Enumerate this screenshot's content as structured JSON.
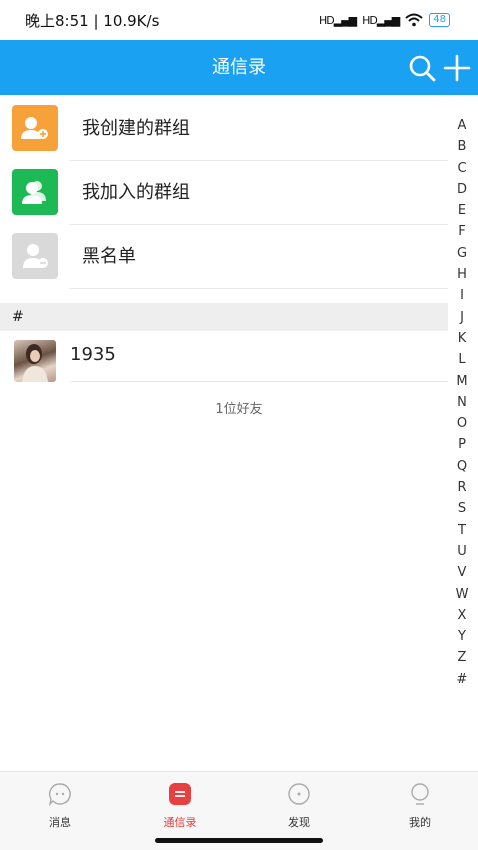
{
  "status_bar": {
    "time": "晚上8:51 | 10.9K/s",
    "battery": "48",
    "signal_1": "HD",
    "signal_2": "HD"
  },
  "header": {
    "title": "通信录"
  },
  "groups": [
    {
      "label": "我创建的群组",
      "icon": "group-add-icon",
      "color": "#f7a13a"
    },
    {
      "label": "我加入的群组",
      "icon": "group-icon",
      "color": "#1db954"
    },
    {
      "label": "黑名单",
      "icon": "user-blocked-icon",
      "color": "#d9d9d9"
    }
  ],
  "section": {
    "label": "#"
  },
  "contacts": [
    {
      "name": "1935"
    }
  ],
  "friend_count": "1位好友",
  "index_letters": [
    "A",
    "B",
    "C",
    "D",
    "E",
    "F",
    "G",
    "H",
    "I",
    "J",
    "K",
    "L",
    "M",
    "N",
    "O",
    "P",
    "Q",
    "R",
    "S",
    "T",
    "U",
    "V",
    "W",
    "X",
    "Y",
    "Z",
    "#"
  ],
  "tabs": [
    {
      "label": "消息",
      "icon": "chat-icon",
      "active": false
    },
    {
      "label": "通信录",
      "icon": "contacts-icon",
      "active": true
    },
    {
      "label": "发现",
      "icon": "discover-icon",
      "active": false
    },
    {
      "label": "我的",
      "icon": "profile-icon",
      "active": false
    }
  ],
  "colors": {
    "header": "#1aa1f2",
    "active_tab": "#e64040"
  }
}
